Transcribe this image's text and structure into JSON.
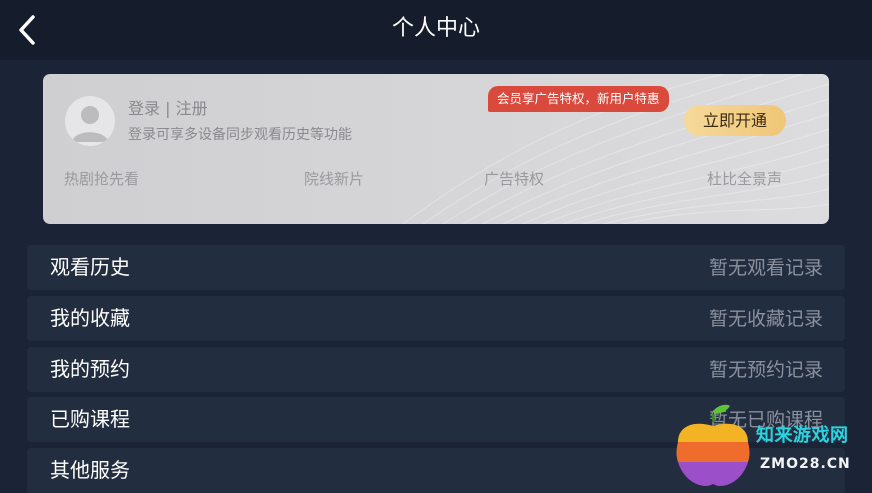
{
  "header": {
    "title": "个人中心",
    "back_icon": "chevron-left-icon"
  },
  "vip_card": {
    "login_text": "登录 | 注册",
    "login_desc": "登录可享多设备同步观看历史等功能",
    "promo_badge": "会员享广告特权，新用户特惠",
    "open_button": "立即开通",
    "perks": [
      "热剧抢先看",
      "院线新片",
      "广告特权",
      "杜比全景声"
    ]
  },
  "menu": [
    {
      "label": "观看历史",
      "value": "暂无观看记录"
    },
    {
      "label": "我的收藏",
      "value": "暂无收藏记录"
    },
    {
      "label": "我的预约",
      "value": "暂无预约记录"
    },
    {
      "label": "已购课程",
      "value": "暂无已购课程"
    },
    {
      "label": "其他服务",
      "value": ""
    }
  ],
  "watermark": {
    "title": "知来游戏网",
    "url": "ZMO28.CN"
  },
  "colors": {
    "background": "#1b2436",
    "topbar": "#151d2c",
    "row": "#222d40",
    "badge": "#d94a3c",
    "gold_button": "#f0c676"
  }
}
